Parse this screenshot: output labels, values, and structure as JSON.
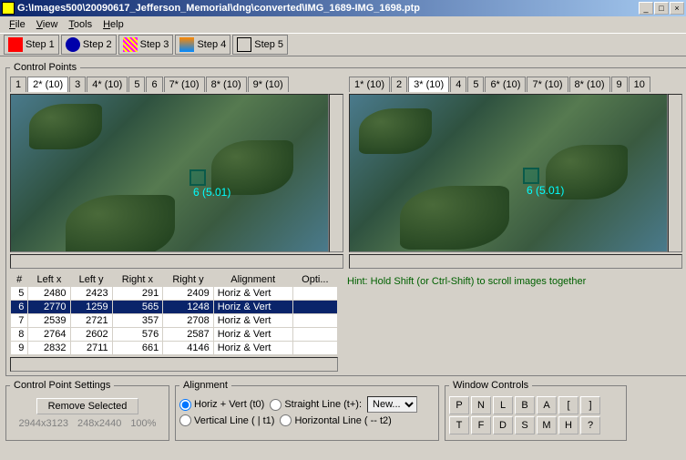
{
  "window": {
    "title": "G:\\Images500\\20090617_Jefferson_Memorial\\dng\\converted\\IMG_1689-IMG_1698.ptp"
  },
  "menu": {
    "file": "File",
    "view": "View",
    "tools": "Tools",
    "help": "Help"
  },
  "steps": [
    "Step 1",
    "Step 2",
    "Step 3",
    "Step 4",
    "Step 5"
  ],
  "control_points_legend": "Control Points",
  "tabs_left": [
    "1",
    "2* (10)",
    "3",
    "4* (10)",
    "5",
    "6",
    "7* (10)",
    "8* (10)",
    "9* (10)"
  ],
  "tabs_right": [
    "1* (10)",
    "2",
    "3* (10)",
    "4",
    "5",
    "6* (10)",
    "7* (10)",
    "8* (10)",
    "9",
    "10"
  ],
  "marker_label": "6 (5.01)",
  "table": {
    "headers": [
      "#",
      "Left x",
      "Left y",
      "Right x",
      "Right y",
      "Alignment",
      "Opti..."
    ],
    "rows": [
      {
        "n": "5",
        "lx": "2480",
        "ly": "2423",
        "rx": "291",
        "ry": "2409",
        "al": "Horiz & Vert"
      },
      {
        "n": "6",
        "lx": "2770",
        "ly": "1259",
        "rx": "565",
        "ry": "1248",
        "al": "Horiz & Vert",
        "sel": true
      },
      {
        "n": "7",
        "lx": "2539",
        "ly": "2721",
        "rx": "357",
        "ry": "2708",
        "al": "Horiz & Vert"
      },
      {
        "n": "8",
        "lx": "2764",
        "ly": "2602",
        "rx": "576",
        "ry": "2587",
        "al": "Horiz & Vert"
      },
      {
        "n": "9",
        "lx": "2832",
        "ly": "2711",
        "rx": "661",
        "ry": "4146",
        "al": "Horiz & Vert"
      }
    ]
  },
  "hint": "Hint: Hold Shift (or Ctrl-Shift) to scroll images together",
  "cps": {
    "legend": "Control Point Settings",
    "remove": "Remove Selected",
    "dim1": "2944x3123",
    "dim2": "248x2440",
    "zoom": "100%"
  },
  "alignment": {
    "legend": "Alignment",
    "hv": "Horiz + Vert (t0)",
    "sl": "Straight Line (t+):",
    "vl": "Vertical Line ( | t1)",
    "hl": "Horizontal Line ( -- t2)",
    "new": "New..."
  },
  "wc": {
    "legend": "Window Controls",
    "row1": [
      "P",
      "N",
      "L",
      "B",
      "A",
      "[",
      "]"
    ],
    "row2": [
      "T",
      "F",
      "D",
      "S",
      "M",
      "H",
      "?"
    ]
  }
}
